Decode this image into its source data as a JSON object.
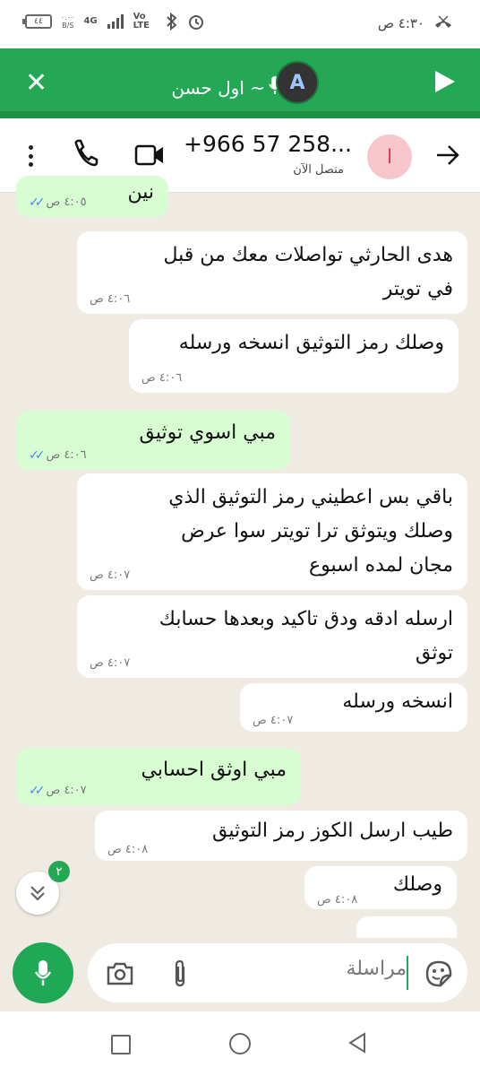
{
  "status_bar": {
    "time": "٤:٣٠ ص",
    "battery": "٤٤",
    "net_speed_value": "٠.٠٠",
    "net_speed_unit": "B/S",
    "network_type": "4G",
    "volte": "Vo LTE"
  },
  "call_banner": {
    "title": "~ اول حسن"
  },
  "chat_header": {
    "contact_name": "+966 57 258...",
    "presence": "متصل الآن",
    "avatar_letter": "ا"
  },
  "messages": [
    {
      "dir": "out",
      "text": [
        "نين"
      ],
      "time": "٤:٠٥ ص"
    },
    {
      "dir": "in",
      "text": [
        "هدى الحارثي تواصلات معك من قبل",
        "في تويتر"
      ],
      "time": "٤:٠٦ ص"
    },
    {
      "dir": "in",
      "text": [
        "وصلك رمز التوثيق انسخه ورسله"
      ],
      "time": "٤:٠٦ ص"
    },
    {
      "dir": "out",
      "text": [
        "مبي اسوي توثيق"
      ],
      "time": "٤:٠٦ ص"
    },
    {
      "dir": "in",
      "text": [
        "باقي بس اعطيني رمز التوثيق الذي",
        "وصلك ويتوثق ترا تويتر سوا عرض",
        "مجان لمده اسبوع"
      ],
      "time": "٤:٠٧ ص"
    },
    {
      "dir": "in",
      "text": [
        "ارسله ادقه ودق تاكيد وبعدها حسابك",
        "توثق"
      ],
      "time": "٤:٠٧ ص"
    },
    {
      "dir": "in",
      "text": [
        "انسخه ورسله"
      ],
      "time": "٤:٠٧ ص"
    },
    {
      "dir": "out",
      "text": [
        "مبي اوثق احسابي"
      ],
      "time": "٤:٠٧ ص"
    },
    {
      "dir": "in",
      "text": [
        "طيب ارسل الكوز رمز التوثيق"
      ],
      "time": "٤:٠٨ ص"
    },
    {
      "dir": "in",
      "text": [
        "وصلك"
      ],
      "time": "٤:٠٨ ص"
    }
  ],
  "scroll_down": {
    "unread_count": "٢"
  },
  "composer": {
    "placeholder": "مراسلة"
  },
  "colors": {
    "accent": "#25a855",
    "outgoing_bubble": "#d9fdd3",
    "incoming_bubble": "#ffffff",
    "read_ticks": "#3d8ef0"
  }
}
